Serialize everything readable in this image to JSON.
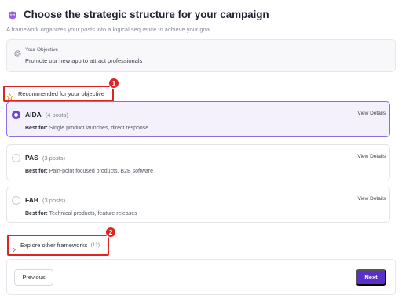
{
  "header": {
    "title": "Choose the strategic structure for your campaign",
    "subtitle": "A framework organizes your posts into a logical sequence to achieve your goal",
    "logo_icon": "purple-mascot-icon"
  },
  "objective": {
    "label": "Your Objective",
    "text": "Promote our new app to attract professionals",
    "icon": "target-icon"
  },
  "recommended": {
    "label": "Recommended for your objective",
    "icon": "star-icon"
  },
  "frameworks": [
    {
      "name": "AIDA",
      "count": "(4 posts)",
      "best_for_label": "Best for:",
      "best_for": "Single product launches, direct response",
      "view_details": "View Details",
      "selected": true
    },
    {
      "name": "PAS",
      "count": "(3 posts)",
      "best_for_label": "Best for:",
      "best_for": "Pain-point focused products, B2B software",
      "view_details": "View Details",
      "selected": false
    },
    {
      "name": "FAB",
      "count": "(3 posts)",
      "best_for_label": "Best for:",
      "best_for": "Technical products, feature releases",
      "view_details": "View Details",
      "selected": false
    }
  ],
  "explore": {
    "label": "Explore other frameworks",
    "count": "(12)"
  },
  "annotations": {
    "badge1": "1",
    "badge2": "2"
  },
  "footer": {
    "previous_label": "Previous",
    "next_label": "Next"
  },
  "colors": {
    "accent": "#5b2fc9",
    "selected_bg": "#f4f1fd",
    "annotation_red": "#e02424"
  }
}
